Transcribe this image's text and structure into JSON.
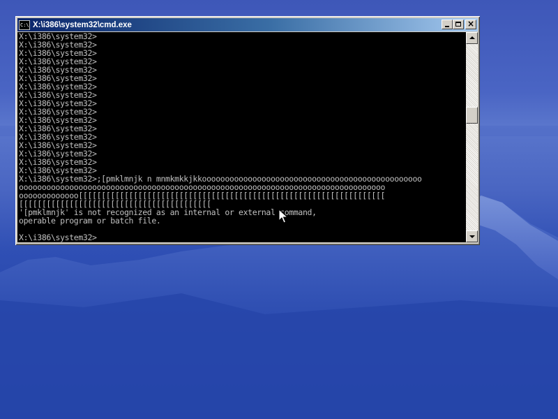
{
  "window": {
    "title": "X:\\i386\\system32\\cmd.exe",
    "icon_label": "C:\\"
  },
  "title_buttons": {
    "minimize": "minimize-icon",
    "maximize": "maximize-icon",
    "close": "×"
  },
  "console": {
    "lines": [
      "X:\\i386\\system32>",
      "X:\\i386\\system32>",
      "X:\\i386\\system32>",
      "X:\\i386\\system32>",
      "X:\\i386\\system32>",
      "X:\\i386\\system32>",
      "X:\\i386\\system32>",
      "X:\\i386\\system32>",
      "X:\\i386\\system32>",
      "X:\\i386\\system32>",
      "X:\\i386\\system32>",
      "X:\\i386\\system32>",
      "X:\\i386\\system32>",
      "X:\\i386\\system32>",
      "X:\\i386\\system32>",
      "X:\\i386\\system32>",
      "X:\\i386\\system32>",
      "X:\\i386\\system32>;[pmklmnjk n mnmkmkkjkkoooooooooooooooooooooooooooooooooooooooooooooooo",
      "oooooooooooooooooooooooooooooooooooooooooooooooooooooooooooooooooooooooooooooooo",
      "ooooooooooooo[[[[[[[[[[[[[[[[[[[[[[[[[[[[[[[[[[[[[[[[[[[[[[[[[[[[[[[[[[[[[[[[[[[",
      "[[[[[[[[[[[[[[[[[[[[[[[[[[[[[[[[[[[[[[[[[[",
      "'[pmklmnjk' is not recognized as an internal or external command,",
      "operable program or batch file.",
      "",
      "X:\\i386\\system32>"
    ]
  },
  "scrollbar": {
    "up": "scroll-up-arrow",
    "down": "scroll-down-arrow",
    "position_fraction": 0.37
  },
  "colors": {
    "console_bg": "#000000",
    "console_text": "#c0c0c0",
    "titlebar_start": "#0a246a",
    "titlebar_end": "#a6caf0"
  }
}
